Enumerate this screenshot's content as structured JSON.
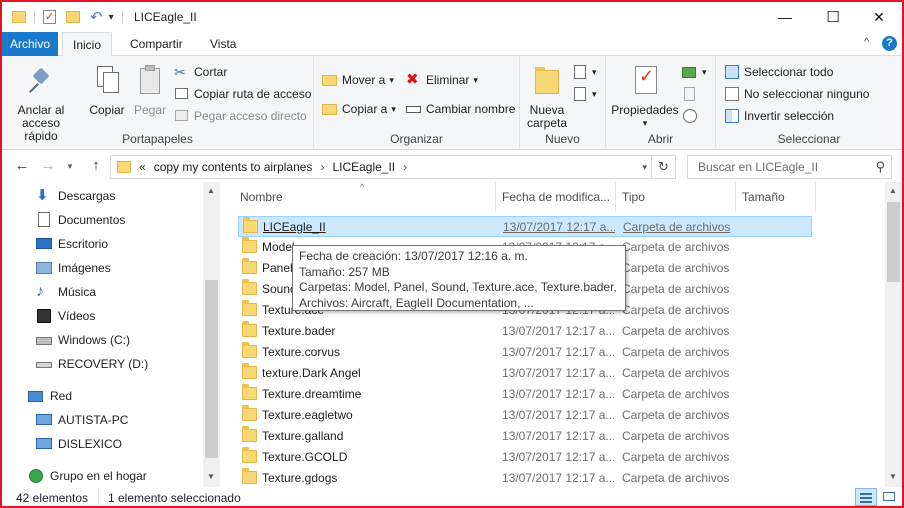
{
  "window": {
    "title": "LICEagle_II",
    "controls": {
      "minimize": "—",
      "maximize": "☐",
      "close": "✕"
    }
  },
  "ribbon_tabs": [
    {
      "label": "Archivo"
    },
    {
      "label": "Inicio"
    },
    {
      "label": "Compartir"
    },
    {
      "label": "Vista"
    }
  ],
  "ribbon": {
    "portapapeles": {
      "label": "Portapapeles",
      "pin": "Anclar al acceso rápido",
      "pin_line1": "Anclar al",
      "pin_line2": "acceso rápido",
      "copy": "Copiar",
      "paste": "Pegar",
      "cut": "Cortar",
      "copy_path": "Copiar ruta de acceso",
      "paste_shortcut": "Pegar acceso directo"
    },
    "organizar": {
      "label": "Organizar",
      "move_to": "Mover a",
      "copy_to": "Copiar a",
      "delete": "Eliminar",
      "rename": "Cambiar nombre"
    },
    "nuevo": {
      "label": "Nuevo",
      "new_folder_line1": "Nueva",
      "new_folder_line2": "carpeta"
    },
    "abrir": {
      "label": "Abrir",
      "properties": "Propiedades"
    },
    "seleccionar": {
      "label": "Seleccionar",
      "select_all": "Seleccionar todo",
      "select_none": "No seleccionar ninguno",
      "invert": "Invertir selección"
    }
  },
  "address": {
    "overflow": "«",
    "crumbs": [
      "copy my contents to airplanes",
      "LICEagle_II"
    ],
    "separator": "›",
    "search_placeholder": "Buscar en LICEagle_II"
  },
  "nav_pane": [
    {
      "label": "Descargas",
      "icon": "download-icon"
    },
    {
      "label": "Documentos",
      "icon": "documents-icon"
    },
    {
      "label": "Escritorio",
      "icon": "desktop-icon"
    },
    {
      "label": "Imágenes",
      "icon": "pictures-icon"
    },
    {
      "label": "Música",
      "icon": "music-icon"
    },
    {
      "label": "Vídeos",
      "icon": "videos-icon"
    },
    {
      "label": "Windows (C:)",
      "icon": "drive-c-icon"
    },
    {
      "label": "RECOVERY (D:)",
      "icon": "drive-d-icon"
    },
    {
      "label": "Red",
      "icon": "network-icon"
    },
    {
      "label": "AUTISTA-PC",
      "icon": "computer-icon"
    },
    {
      "label": "DISLEXICO",
      "icon": "computer-icon"
    },
    {
      "label": "Grupo en el hogar",
      "icon": "homegroup-icon"
    }
  ],
  "columns": [
    {
      "label": "Nombre"
    },
    {
      "label": "Fecha de modifica..."
    },
    {
      "label": "Tipo"
    },
    {
      "label": "Tamaño"
    }
  ],
  "files": [
    {
      "name": "LICEagle_II",
      "date": "13/07/2017 12:17 a...",
      "type": "Carpeta de archivos"
    },
    {
      "name": "Model",
      "date": "13/07/2017 12:17 a...",
      "type": "Carpeta de archivos"
    },
    {
      "name": "Panel",
      "date": "13/07/2017 12:17 a...",
      "type": "Carpeta de archivos"
    },
    {
      "name": "Sound",
      "date": "13/07/2017 12:17 a...",
      "type": "Carpeta de archivos"
    },
    {
      "name": "Texture.ace",
      "date": "13/07/2017 12:17 a...",
      "type": "Carpeta de archivos"
    },
    {
      "name": "Texture.bader",
      "date": "13/07/2017 12:17 a...",
      "type": "Carpeta de archivos"
    },
    {
      "name": "Texture.corvus",
      "date": "13/07/2017 12:17 a...",
      "type": "Carpeta de archivos"
    },
    {
      "name": "texture.Dark Angel",
      "date": "13/07/2017 12:17 a...",
      "type": "Carpeta de archivos"
    },
    {
      "name": "Texture.dreamtime",
      "date": "13/07/2017 12:17 a...",
      "type": "Carpeta de archivos"
    },
    {
      "name": "Texture.eagletwo",
      "date": "13/07/2017 12:17 a...",
      "type": "Carpeta de archivos"
    },
    {
      "name": "Texture.galland",
      "date": "13/07/2017 12:17 a...",
      "type": "Carpeta de archivos"
    },
    {
      "name": "Texture.GCOLD",
      "date": "13/07/2017 12:17 a...",
      "type": "Carpeta de archivos"
    },
    {
      "name": "Texture.gdogs",
      "date": "13/07/2017 12:17 a...",
      "type": "Carpeta de archivos"
    }
  ],
  "tooltip": {
    "created": "Fecha de creación: 13/07/2017 12:16 a. m.",
    "size": "Tamaño: 257 MB",
    "folders": "Carpetas: Model, Panel, Sound, Texture.ace, Texture.bader, ...",
    "files": "Archivos: Aircraft, EagleII Documentation, ..."
  },
  "status": {
    "count": "42 elementos",
    "selected": "1 elemento seleccionado"
  },
  "colors": {
    "accent": "#1979ca",
    "window_border": "#e81123",
    "selection": "#cce8ff",
    "folder": "#f8d775"
  }
}
